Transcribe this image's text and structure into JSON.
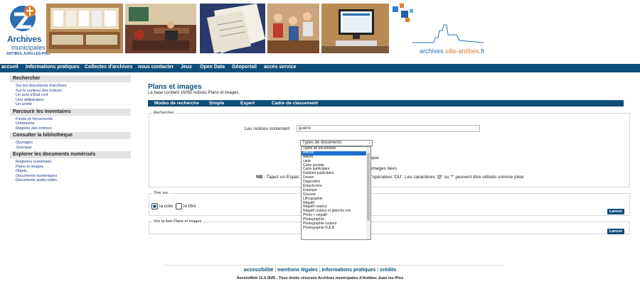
{
  "header": {
    "logo_line1": "Archives",
    "logo_line2": "municipales",
    "logo_line3": "ANTIBES JUAN-LES-PINS",
    "site_url_prefix": "archives.",
    "site_url_accent": "ville-antibes",
    "site_url_suffix": ".fr"
  },
  "nav": {
    "items": [
      "accueil",
      "Informations pratiques",
      "Collectes d'archives",
      "nous contacter",
      "Jeux",
      "Open Data",
      "Géoportail",
      "accès service"
    ]
  },
  "sidebar": {
    "sections": [
      {
        "title": "Rechercher",
        "links": [
          "Sur les documents d'archives",
          "Sur le contenu des notices",
          "Un acte d'État civil",
          "Une délibération",
          "Un arrêté"
        ]
      },
      {
        "title": "Parcourir les inventaires",
        "links": [
          "Fonds et Versements",
          "Urbanisme",
          "Registre des entrées"
        ]
      },
      {
        "title": "Consulter la bibliothèque",
        "links": [
          "Ouvrages",
          "Journaux"
        ]
      },
      {
        "title": "Explorer les documents numérisés",
        "links": [
          "Registres numérisés",
          "Plans et images",
          "Objets",
          "Documents numériques",
          "Documents audio-vidéo"
        ]
      }
    ]
  },
  "main": {
    "title": "Plans et images",
    "subtitle": "La base contient 16050 notices Plans et images.",
    "tabs": [
      "Modes de recherche",
      "Simple",
      "Expert",
      "Cadre de classement"
    ]
  },
  "search": {
    "legend": "Rechercher",
    "label": "Les notices contenant",
    "value": "guerre",
    "select_value": "Types de documents",
    "partial_right_1": "que",
    "partial_right_2": "images liées",
    "nb_prefix": "NB",
    "nb_text_left": " : Tapez un Espac",
    "nb_text_right": "l'opérateur 'OU'. Les caractères '@' ou '*' peuvent être utilisés comme joker"
  },
  "dropdown": {
    "selected_index": 1,
    "options": [
      "Types de documents",
      "Affiche",
      "Album",
      "carte",
      "Carte postale",
      "Carte publicitaire",
      "Dépliant publicitaire",
      "Dessin",
      "Diapositive",
      "Ektachrome",
      "Estampe",
      "Gravure",
      "Lithographie",
      "Négatif",
      "Négatif couleur",
      "Négatif couleur et planche con",
      "Photo + négatif",
      "Photographie",
      "Photographie couleur",
      "Photographie N & B"
    ]
  },
  "sort": {
    "legend": "Trier sur",
    "option_cote": "la cote",
    "option_titre": "le titre",
    "button": "Lancer"
  },
  "list": {
    "legend": "Voir la liste Plans et images",
    "button": "Lancer"
  },
  "footer": {
    "links": [
      "accessibilité",
      "mentions légales",
      "Informations pratiques",
      "crédits"
    ],
    "copyright": "AvenioWeb 11.5.5hf5 - Tous droits réservés Archives municipales d'Antibes Juan-les-Pins"
  }
}
